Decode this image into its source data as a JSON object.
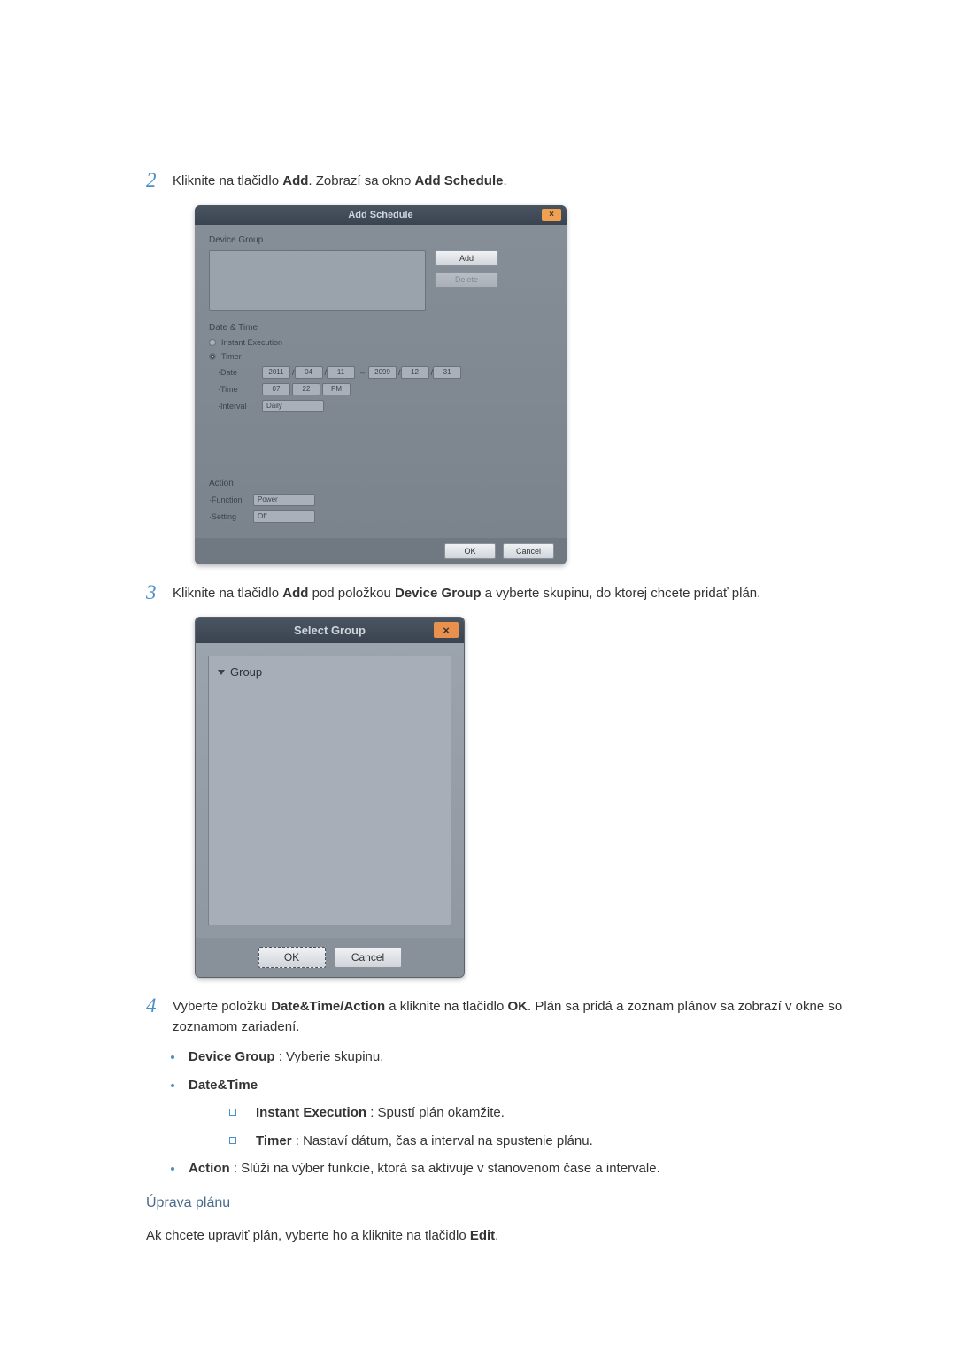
{
  "step2": {
    "num": "2",
    "text_pre": "Kliknite na tlačidlo ",
    "text_bold1": "Add",
    "text_mid": ". Zobrazí sa okno ",
    "text_bold2": "Add Schedule",
    "text_post": "."
  },
  "dialog1": {
    "title": "Add Schedule",
    "close": "×",
    "device_group_label": "Device Group",
    "add_btn": "Add",
    "delete_btn": "Delete",
    "date_time_label": "Date & Time",
    "instant_label": "Instant Execution",
    "timer_label": "Timer",
    "date_label": "·Date",
    "date_y1": "2011",
    "date_m1": "04",
    "date_d1": "11",
    "date_y2": "2099",
    "date_m2": "12",
    "date_d2": "31",
    "time_label": "·Time",
    "time_h": "07",
    "time_m": "22",
    "time_ampm": "PM",
    "interval_label": "·Interval",
    "interval_val": "Daily",
    "action_label": "Action",
    "function_label": "·Function",
    "function_val": "Power",
    "setting_label": "·Setting",
    "setting_val": "Off",
    "ok_btn": "OK",
    "cancel_btn": "Cancel"
  },
  "step3": {
    "num": "3",
    "text_pre": "Kliknite na tlačidlo ",
    "text_bold1": "Add",
    "text_mid": " pod položkou ",
    "text_bold2": "Device Group",
    "text_post": " a vyberte skupinu, do ktorej chcete pridať plán."
  },
  "dialog2": {
    "title": "Select Group",
    "close": "×",
    "group_label": "Group",
    "ok_btn": "OK",
    "cancel_btn": "Cancel"
  },
  "step4": {
    "num": "4",
    "text_pre": "Vyberte položku ",
    "text_bold1": "Date&Time/Action",
    "text_mid1": " a kliknite na tlačidlo ",
    "text_bold2": "OK",
    "text_post": ". Plán sa pridá a zoznam plánov sa zobrazí v okne so zoznamom zariadení."
  },
  "bullets": {
    "b1_bold": "Device Group",
    "b1_text": " : Vyberie skupinu.",
    "b2_bold": "Date&Time",
    "b2s1_bold": "Instant Execution",
    "b2s1_text": " : Spustí plán okamžite.",
    "b2s2_bold": "Timer",
    "b2s2_text": " : Nastaví dátum, čas a interval na spustenie plánu.",
    "b3_bold": "Action",
    "b3_text": " : Slúži na výber funkcie, ktorá sa aktivuje v stanovenom čase a intervale."
  },
  "sub_heading": "Úprava plánu",
  "edit_text_pre": "Ak chcete upraviť plán, vyberte ho a kliknite na tlačidlo ",
  "edit_text_bold": "Edit",
  "edit_text_post": "."
}
